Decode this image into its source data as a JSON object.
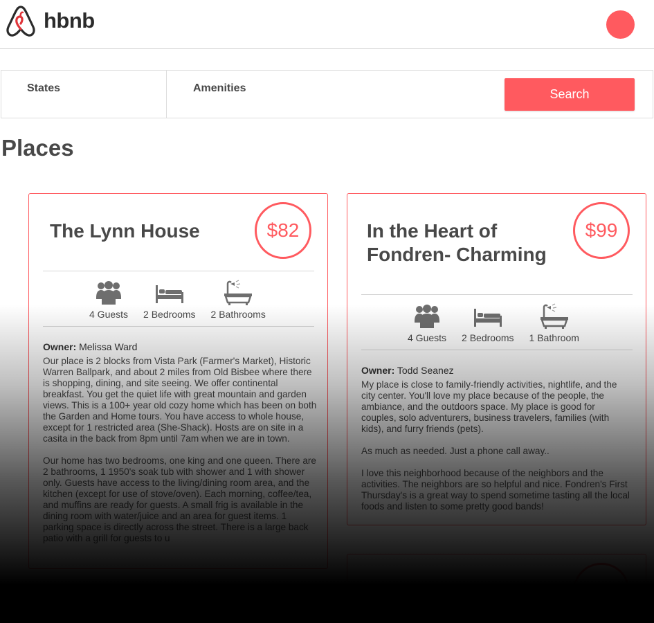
{
  "header": {
    "brand": "hbnb",
    "logo_icon": "airbnb-logo-icon",
    "accent_color": "#ff5a5f"
  },
  "filters": {
    "states_label": "States",
    "amenities_label": "Amenities",
    "search_label": "Search"
  },
  "page": {
    "title": "Places"
  },
  "places": [
    {
      "name": "The Lynn House",
      "price": "$82",
      "guests": "4 Guests",
      "bedrooms": "2 Bedrooms",
      "bathrooms": "2 Bathrooms",
      "owner_label": "Owner:",
      "owner": "Melissa Ward",
      "description": "Our place is 2 blocks from Vista Park (Farmer's Market), Historic Warren Ballpark, and about 2 miles from Old Bisbee where there is shopping, dining, and site seeing. We offer continental breakfast. You get the quiet life with great mountain and garden views. This is a 100+ year old cozy home which has been on both the Garden and Home tours. You have access to whole house, except for 1 restricted area (She-Shack). Hosts are on site in a casita in the back from 8pm until 7am when we are in town.\n\nOur home has two bedrooms, one king and one queen. There are 2 bathrooms, 1 1950's soak tub with shower and 1 with shower only. Guests have access to the living/dining room area, and the kitchen (except for use of stove/oven). Each morning, coffee/tea, and muffins are ready for guests. A small frig is available in the dining room with water/juice and an area for guest items. 1 parking space is directly across the street. There is a large back patio with a grill for guests to u"
    },
    {
      "name": "In the Heart of Fondren- Charming",
      "price": "$99",
      "guests": "4 Guests",
      "bedrooms": "2 Bedrooms",
      "bathrooms": "1 Bathroom",
      "owner_label": "Owner:",
      "owner": "Todd Seanez",
      "description": "My place is close to family-friendly activities, nightlife, and the city center. You'll love my place because of the people, the ambiance, and the outdoors space. My place is good for couples, solo adventurers, business travelers, families (with kids), and furry friends (pets).\n\nAs much as needed. Just a phone call away..\n\nI love this neighborhood because of the neighbors and the activities. The neighbors are so helpful and nice. Fondren's First Thursday's is a great way to spend sometime tasting all the local foods and listen to some pretty good bands!"
    }
  ],
  "icons": {
    "guests": "guests-icon",
    "bedrooms": "bed-icon",
    "bathrooms": "bathtub-icon"
  }
}
